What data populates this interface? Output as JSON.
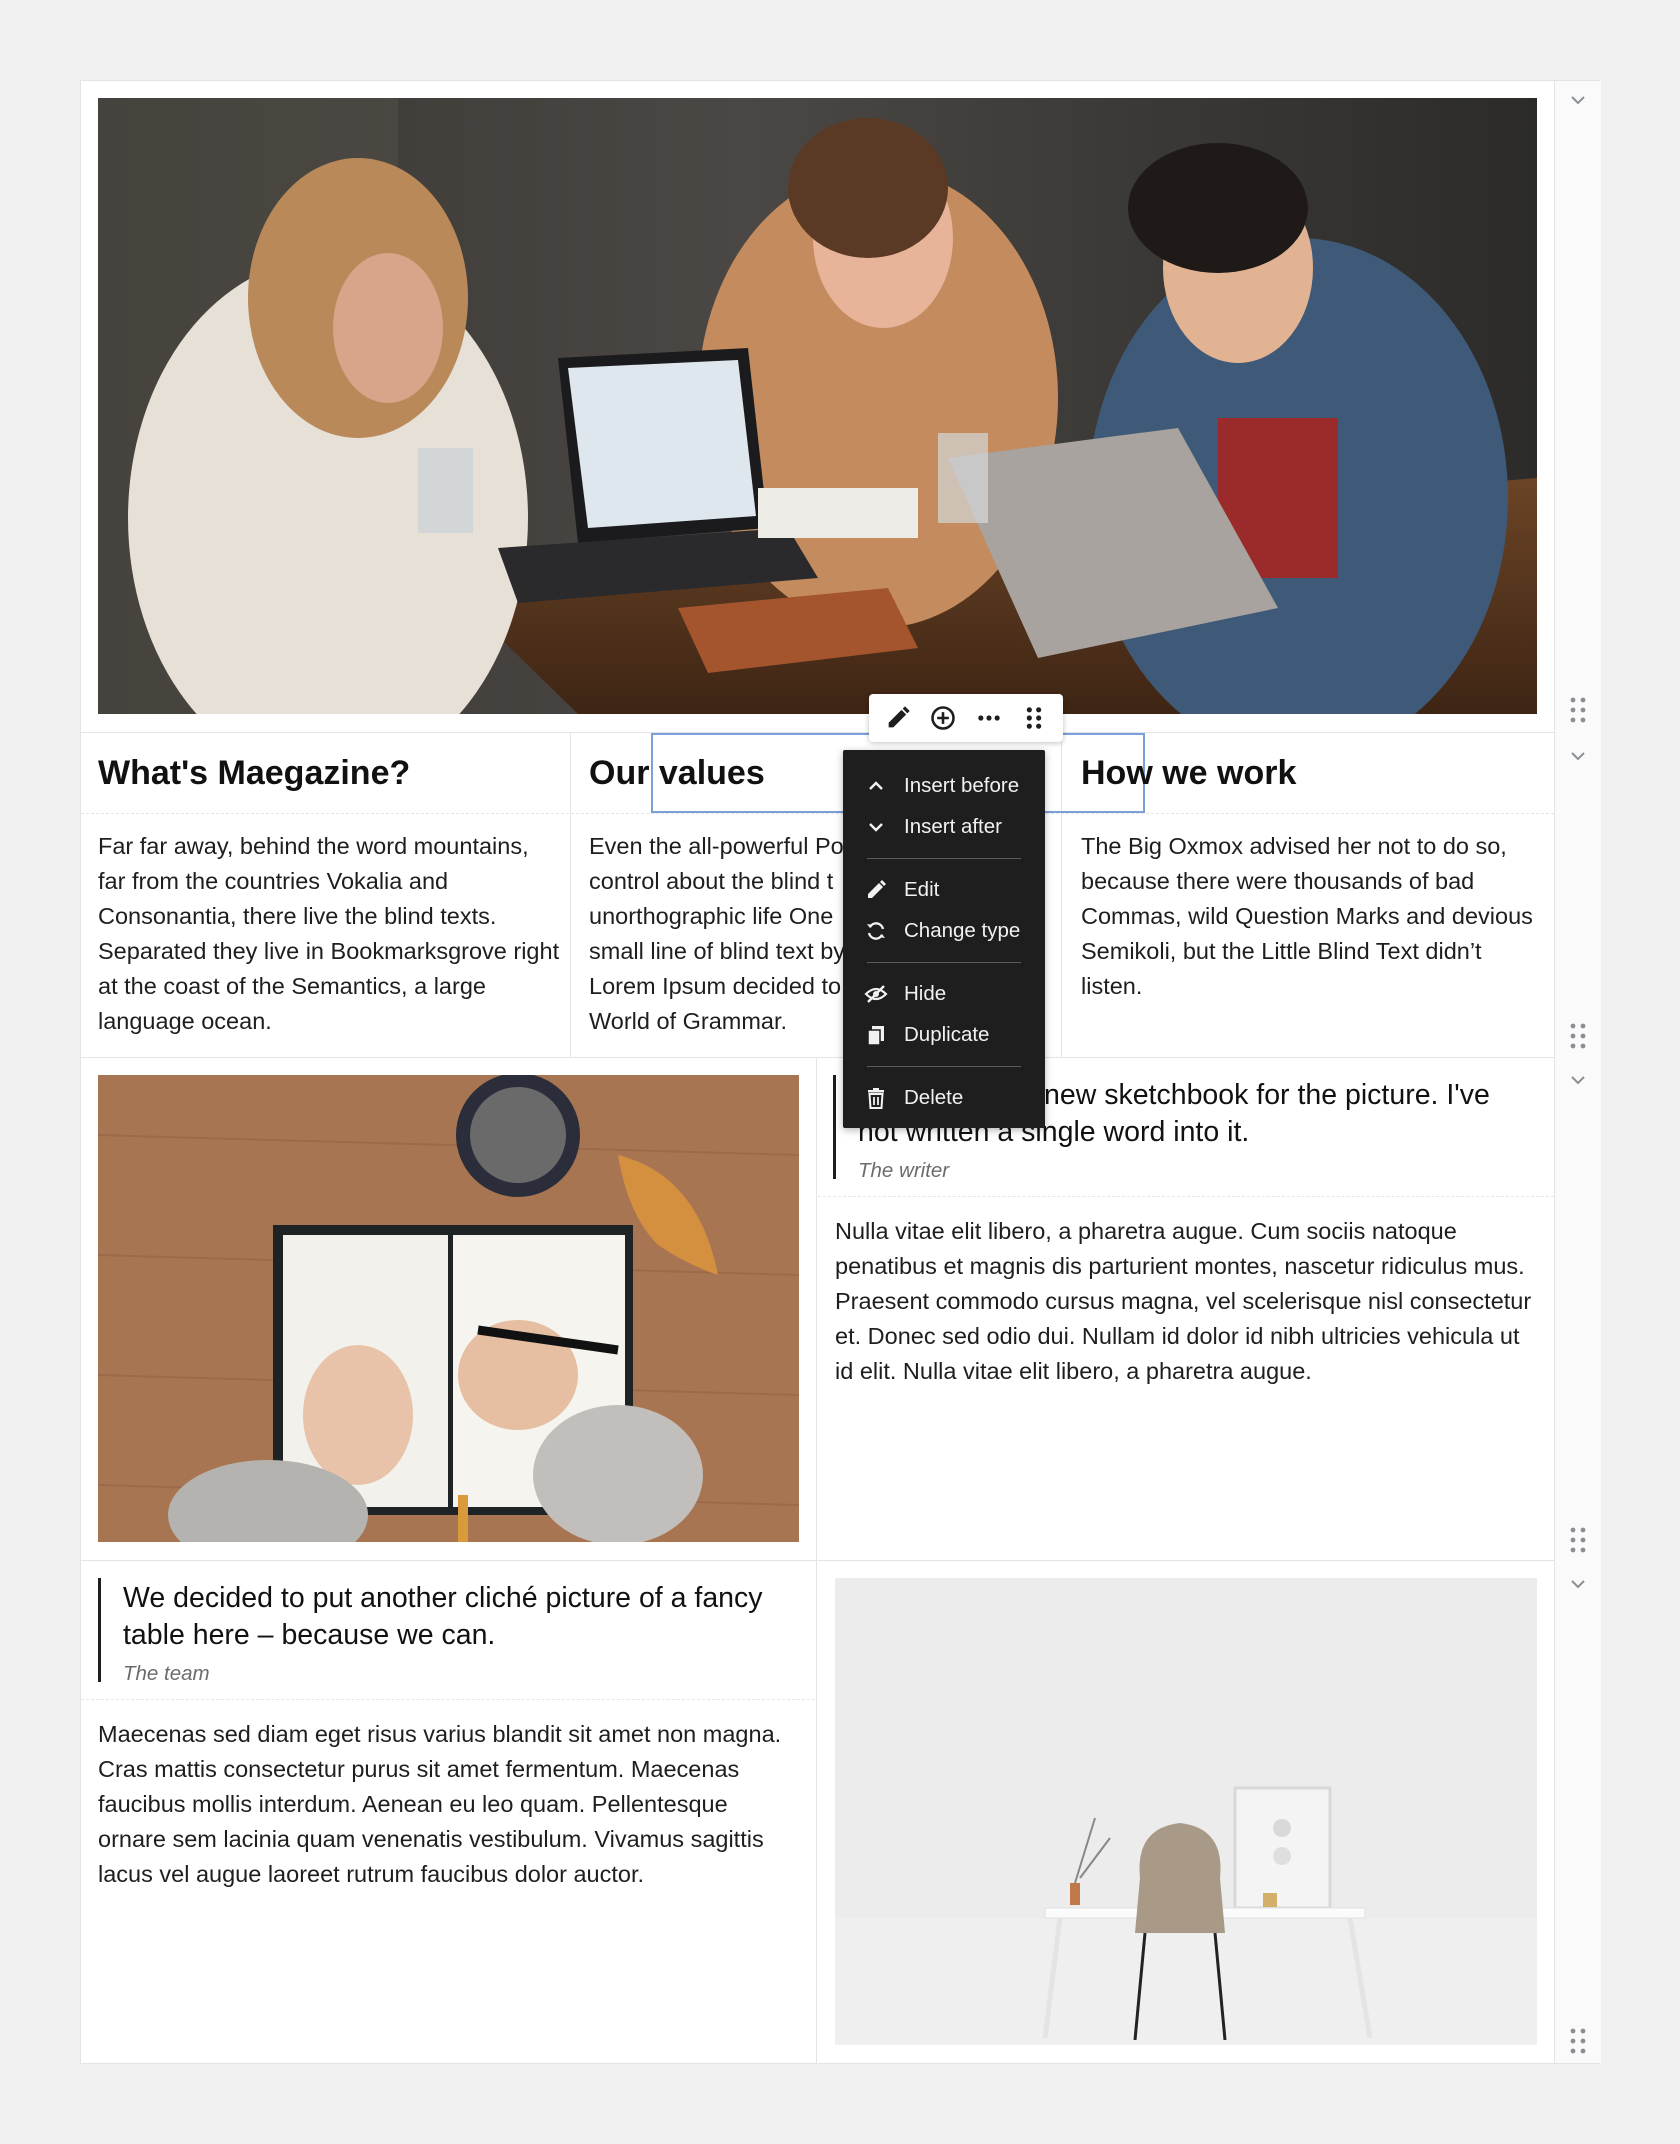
{
  "toolbar": {
    "edit_icon": "pencil-icon",
    "add_icon": "plus-circle-icon",
    "more_icon": "ellipsis-icon",
    "drag_icon": "drag-handle-icon"
  },
  "context_menu": {
    "insert_before": "Insert before",
    "insert_after": "Insert after",
    "edit": "Edit",
    "change_type": "Change type",
    "hide": "Hide",
    "duplicate": "Duplicate",
    "delete": "Delete"
  },
  "columns_row": {
    "col1": {
      "heading": "What's Maegazine?",
      "text": "Far far away, behind the word mountains, far from the countries Vokalia and Consonantia, there live the blind texts. Separated they live in Bookmarksgrove right at the coast of the Semantics, a large language ocean."
    },
    "col2": {
      "heading": "Our values",
      "text_lines": [
        "Even the all-powerful Po",
        "control about the blind t",
        "unorthographic life One",
        "small line of blind text by",
        "Lorem Ipsum decided to",
        "World of Grammar."
      ]
    },
    "col3": {
      "heading": "How we work",
      "text": "The Big Oxmox advised her not to do so, because there were thousands of bad Commas, wild Question Marks and devious Semikoli, but the Little Blind Text didn’t listen."
    }
  },
  "row2": {
    "quote_lines": [
      "new sketchbook for the picture. I've",
      "not written a single word into it."
    ],
    "quote_cite": "The writer",
    "text": "Nulla vitae elit libero, a pharetra augue. Cum sociis natoque penatibus et magnis dis parturient montes, nascetur ridiculus mus. Praesent commodo cursus magna, vel scelerisque nisl consectetur et. Donec sed odio dui. Nullam id dolor id nibh ultricies vehicula ut id elit. Nulla vitae elit libero, a pharetra augue."
  },
  "row3": {
    "quote": "We decided to put another cliché picture of a fancy table here – because we can.",
    "quote_cite": "The team",
    "text": "Maecenas sed diam eget risus varius blandit sit amet non magna. Cras mattis consectetur purus sit amet fermentum. Maecenas faucibus mollis interdum. Aenean eu leo quam. Pellentesque ornare sem lacinia quam venenatis vestibulum. Vivamus sagittis lacus vel augue laoreet rutrum faucibus dolor auctor."
  },
  "colors": {
    "accent_border": "#7a9fd9",
    "menu_bg": "#1e1e1e",
    "page_bg": "#f0f0f1"
  }
}
